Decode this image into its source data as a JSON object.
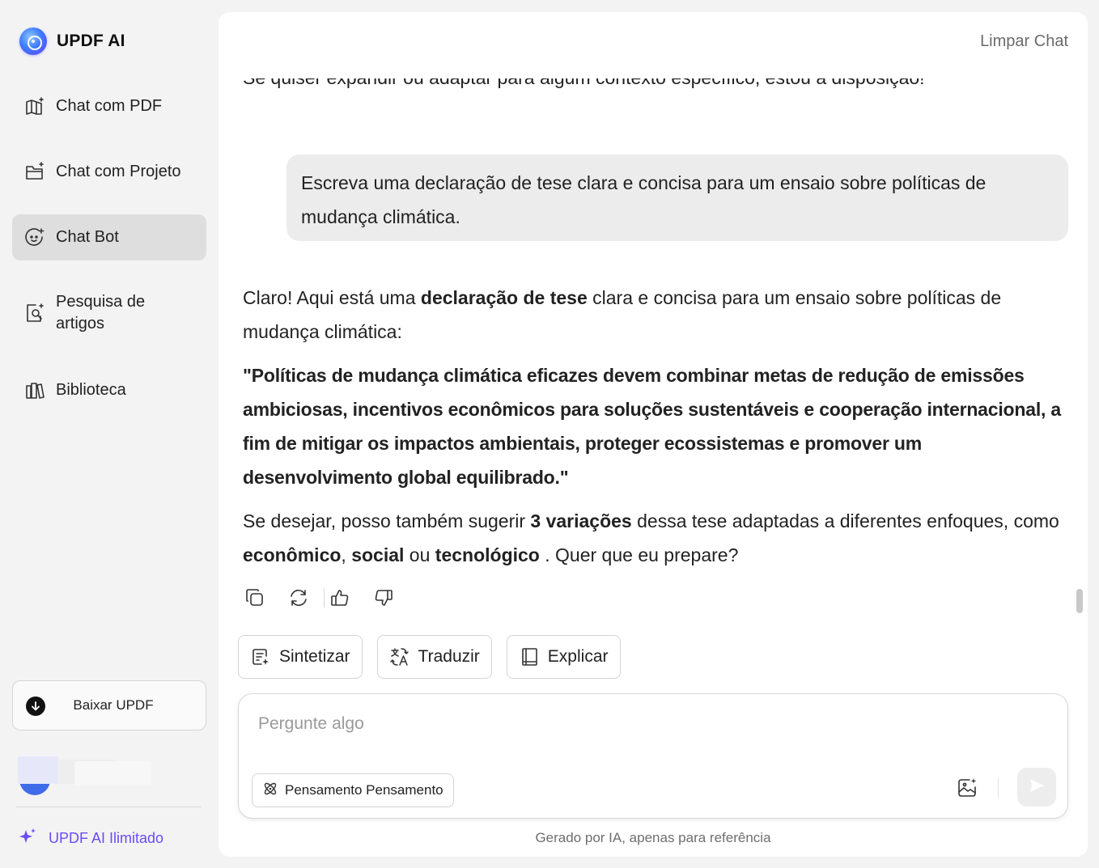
{
  "brand": {
    "name": "UPDF AI",
    "logo_icon": "updf-ai-logo"
  },
  "sidebar": {
    "items": [
      {
        "label": "Chat com PDF",
        "icon": "book-sparkle-icon",
        "active": false
      },
      {
        "label": "Chat com Projeto",
        "icon": "folder-sparkle-icon",
        "active": false
      },
      {
        "label": "Chat Bot",
        "icon": "bot-face-icon",
        "active": true
      },
      {
        "label": "Pesquisa de artigos",
        "icon": "search-document-icon",
        "active": false
      },
      {
        "label": "Biblioteca",
        "icon": "library-icon",
        "active": false
      }
    ],
    "download_label": "Baixar UPDF",
    "unlimited_label": "UPDF AI Ilimitado"
  },
  "header": {
    "clear_chat": "Limpar Chat"
  },
  "chat": {
    "previous_tail": "Se quiser expandir ou adaptar para algum contexto específico, estou à disposição!",
    "user_message": "Escreva uma declaração de tese clara e concisa para um ensaio sobre políticas de mudança climática.",
    "answer": {
      "p1_start": "Claro! Aqui está uma ",
      "p1_bold": "declaração de tese",
      "p1_end": " clara e concisa para um ensaio sobre políticas de mudança climática:",
      "thesis": "\"Políticas de mudança climática eficazes devem combinar metas de redução de emissões ambiciosas, incentivos econômicos para soluções sustentáveis e cooperação internacional, a fim de mitigar os impactos ambientais, proteger ecossistemas e promover um desenvolvimento global equilibrado.\"",
      "p3_a": "Se desejar, posso também sugerir ",
      "p3_b": "3 variações",
      "p3_c": " dessa tese adaptadas a diferentes enfoques, como ",
      "p3_d": "econômico",
      "p3_e": ", ",
      "p3_f": "social",
      "p3_g": " ou ",
      "p3_h": "tecnológico",
      "p3_i": " . Quer que eu prepare?"
    }
  },
  "quick_actions": [
    {
      "label": "Sintetizar",
      "icon": "summarize-icon"
    },
    {
      "label": "Traduzir",
      "icon": "translate-icon"
    },
    {
      "label": "Explicar",
      "icon": "book-icon"
    }
  ],
  "composer": {
    "placeholder": "Pergunte algo",
    "value": "",
    "thinking_label": "Pensamento Pensamento"
  },
  "footer": {
    "disclaimer": "Gerado por IA, apenas para referência"
  },
  "colors": {
    "accent": "#6b4cf6",
    "active_bg": "#dedede",
    "bubble_bg": "#ececec"
  }
}
